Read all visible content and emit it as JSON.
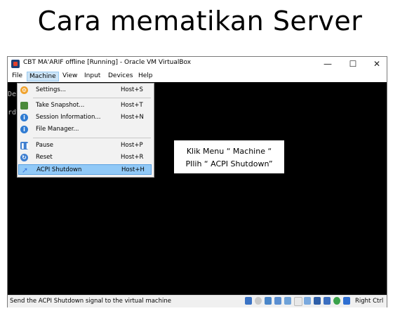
{
  "page": {
    "title": "Cara mematikan Server"
  },
  "window": {
    "title": "CBT MA'ARIF offline [Running] - Oracle VM VirtualBox",
    "controls": [
      "—",
      "☐",
      "✕"
    ]
  },
  "menubar": {
    "items": [
      "File",
      "Machine",
      "View",
      "Input",
      "Devices",
      "Help"
    ]
  },
  "screen": {
    "lines": [
      "Debi",
      "rdtm"
    ]
  },
  "machine_menu": {
    "items": [
      {
        "label": "Settings...",
        "shortcut": "Host+S",
        "icon": "settings-gear-icon",
        "color": "#f0a22c"
      },
      {
        "label": "Take Snapshot...",
        "shortcut": "Host+T",
        "icon": "snapshot-camera-icon",
        "color": "#4b8a3a"
      },
      {
        "label": "Session Information...",
        "shortcut": "Host+N",
        "icon": "info-icon",
        "color": "#2f7bd2"
      },
      {
        "label": "File Manager...",
        "shortcut": "",
        "icon": "file-manager-icon",
        "color": "#2f7bd2"
      },
      {
        "label": "Pause",
        "shortcut": "Host+P",
        "icon": "pause-icon",
        "color": "#3f7fd0"
      },
      {
        "label": "Reset",
        "shortcut": "Host+R",
        "icon": "reset-icon",
        "color": "#3f7fd0"
      },
      {
        "label": "ACPI Shutdown",
        "shortcut": "Host+H",
        "icon": "acpi-shutdown-icon",
        "color": "#3c7be0"
      }
    ]
  },
  "callout": {
    "line1": "Klik Menu “ Machine “",
    "line2": "PIlih “ ACPI Shutdown”"
  },
  "statusbar": {
    "text": "Send the ACPI Shutdown signal to the virtual machine",
    "host_key": "Right Ctrl",
    "tray_icons": [
      "hard-disk-icon",
      "optical-drive-icon",
      "audio-icon",
      "network-icon",
      "usb-icon",
      "shared-folders-icon",
      "display-icon",
      "video-capture-icon",
      "cpu-icon",
      "guest-additions-icon",
      "mouse-integration-icon"
    ]
  }
}
